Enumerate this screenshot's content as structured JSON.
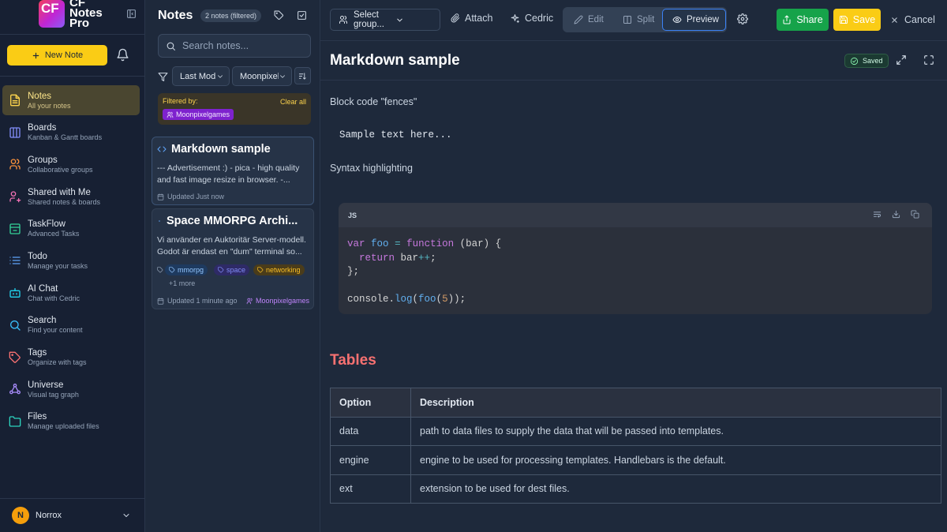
{
  "app": {
    "logo_text": "CF",
    "brand_line1": "CF",
    "brand_line2": "Notes",
    "brand_line3": "Pro",
    "new_note_label": "New Note",
    "nav": [
      {
        "title": "Notes",
        "subtitle": "All your notes",
        "icon": "file-text-icon",
        "active": true
      },
      {
        "title": "Boards",
        "subtitle": "Kanban & Gantt boards",
        "icon": "columns-icon"
      },
      {
        "title": "Groups",
        "subtitle": "Collaborative groups",
        "icon": "users-icon"
      },
      {
        "title": "Shared with Me",
        "subtitle": "Shared notes & boards",
        "icon": "user-share-icon"
      },
      {
        "title": "TaskFlow",
        "subtitle": "Advanced Tasks",
        "icon": "taskflow-icon"
      },
      {
        "title": "Todo",
        "subtitle": "Manage your tasks",
        "icon": "list-icon"
      },
      {
        "title": "AI Chat",
        "subtitle": "Chat with Cedric",
        "icon": "bot-icon"
      },
      {
        "title": "Search",
        "subtitle": "Find your content",
        "icon": "search-icon"
      },
      {
        "title": "Tags",
        "subtitle": "Organize with tags",
        "icon": "tag-icon"
      },
      {
        "title": "Universe",
        "subtitle": "Visual tag graph",
        "icon": "graph-icon"
      },
      {
        "title": "Files",
        "subtitle": "Manage uploaded files",
        "icon": "folder-icon"
      }
    ],
    "user": {
      "initial": "N",
      "name": "Norrox"
    }
  },
  "notes_panel": {
    "title": "Notes",
    "count_badge": "2 notes (filtered)",
    "search_placeholder": "Search notes...",
    "sort_select": "Last Modified",
    "group_select": "Moonpixelgames",
    "filtered_by_label": "Filtered by:",
    "clear_all_label": "Clear all",
    "filter_chip": "Moonpixelgames",
    "cards": [
      {
        "title": "Markdown sample",
        "excerpt": "--- Advertisement :) - pica - high quality and fast image resize in browser. -...",
        "updated": "Updated Just now"
      },
      {
        "title": "Space MMORPG Archi...",
        "excerpt": "Vi använder en Auktoritär Server-modell. Godot är endast en \"dum\" terminal so...",
        "tags": [
          "mmorpg",
          "space",
          "networking"
        ],
        "more": "+1 more",
        "updated": "Updated 1 minute ago",
        "group": "Moonpixelgames"
      }
    ]
  },
  "editor": {
    "group_select_placeholder": "Select group...",
    "attach_label": "Attach",
    "cedric_label": "Cedric",
    "mode_edit": "Edit",
    "mode_split": "Split",
    "mode_preview": "Preview",
    "active_mode": "Preview",
    "share_label": "Share",
    "save_label": "Save",
    "cancel_label": "Cancel",
    "doc_title": "Markdown sample",
    "saved_label": "Saved",
    "colors": {
      "accent": "#3b82f6",
      "share": "#16a34a",
      "save": "#facc15",
      "heading": "#f87171"
    },
    "content": {
      "p1": "Block code \"fences\"",
      "plain_code": "Sample text here...",
      "p2": "Syntax highlighting",
      "code_lang": "JS",
      "code_lines": [
        "var foo = function (bar) {",
        "  return bar++;",
        "};",
        "",
        "console.log(foo(5));"
      ],
      "heading": "Tables",
      "table": {
        "headers": [
          "Option",
          "Description"
        ],
        "rows": [
          [
            "data",
            "path to data files to supply the data that will be passed into templates."
          ],
          [
            "engine",
            "engine to be used for processing templates. Handlebars is the default."
          ],
          [
            "ext",
            "extension to be used for dest files."
          ]
        ]
      }
    }
  }
}
